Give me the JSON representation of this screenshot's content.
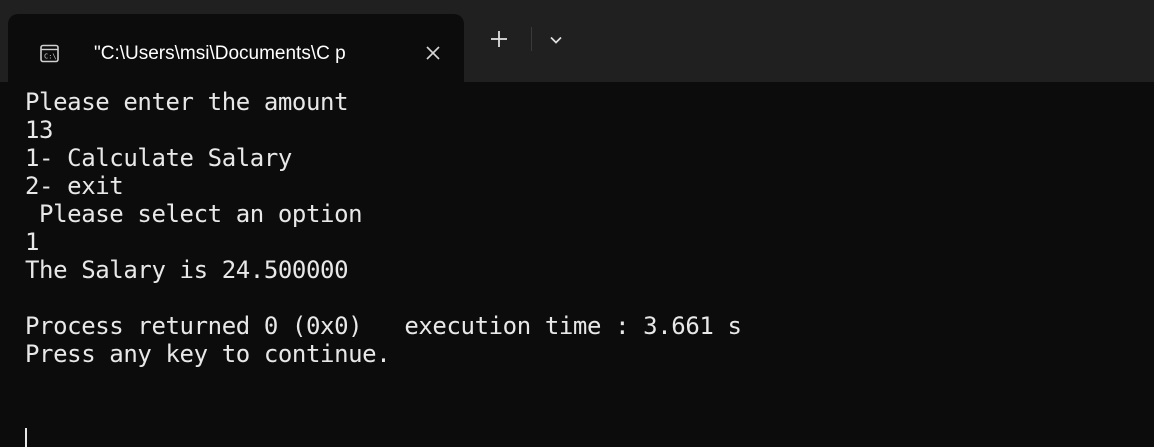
{
  "tab": {
    "title": "\"C:\\Users\\msi\\Documents\\C p",
    "icon": "terminal-app-icon"
  },
  "toolbar": {
    "close_icon": "close-icon",
    "new_tab_icon": "plus-icon",
    "dropdown_icon": "chevron-down-icon"
  },
  "console": {
    "lines": [
      "Please enter the amount",
      "13",
      "1- Calculate Salary",
      "2- exit",
      " Please select an option",
      "1",
      "The Salary is 24.500000",
      "",
      "Process returned 0 (0x0)   execution time : 3.661 s",
      "Press any key to continue."
    ]
  },
  "colors": {
    "background": "#0c0c0c",
    "tabbar": "#202020",
    "text": "#e8e8e8"
  }
}
